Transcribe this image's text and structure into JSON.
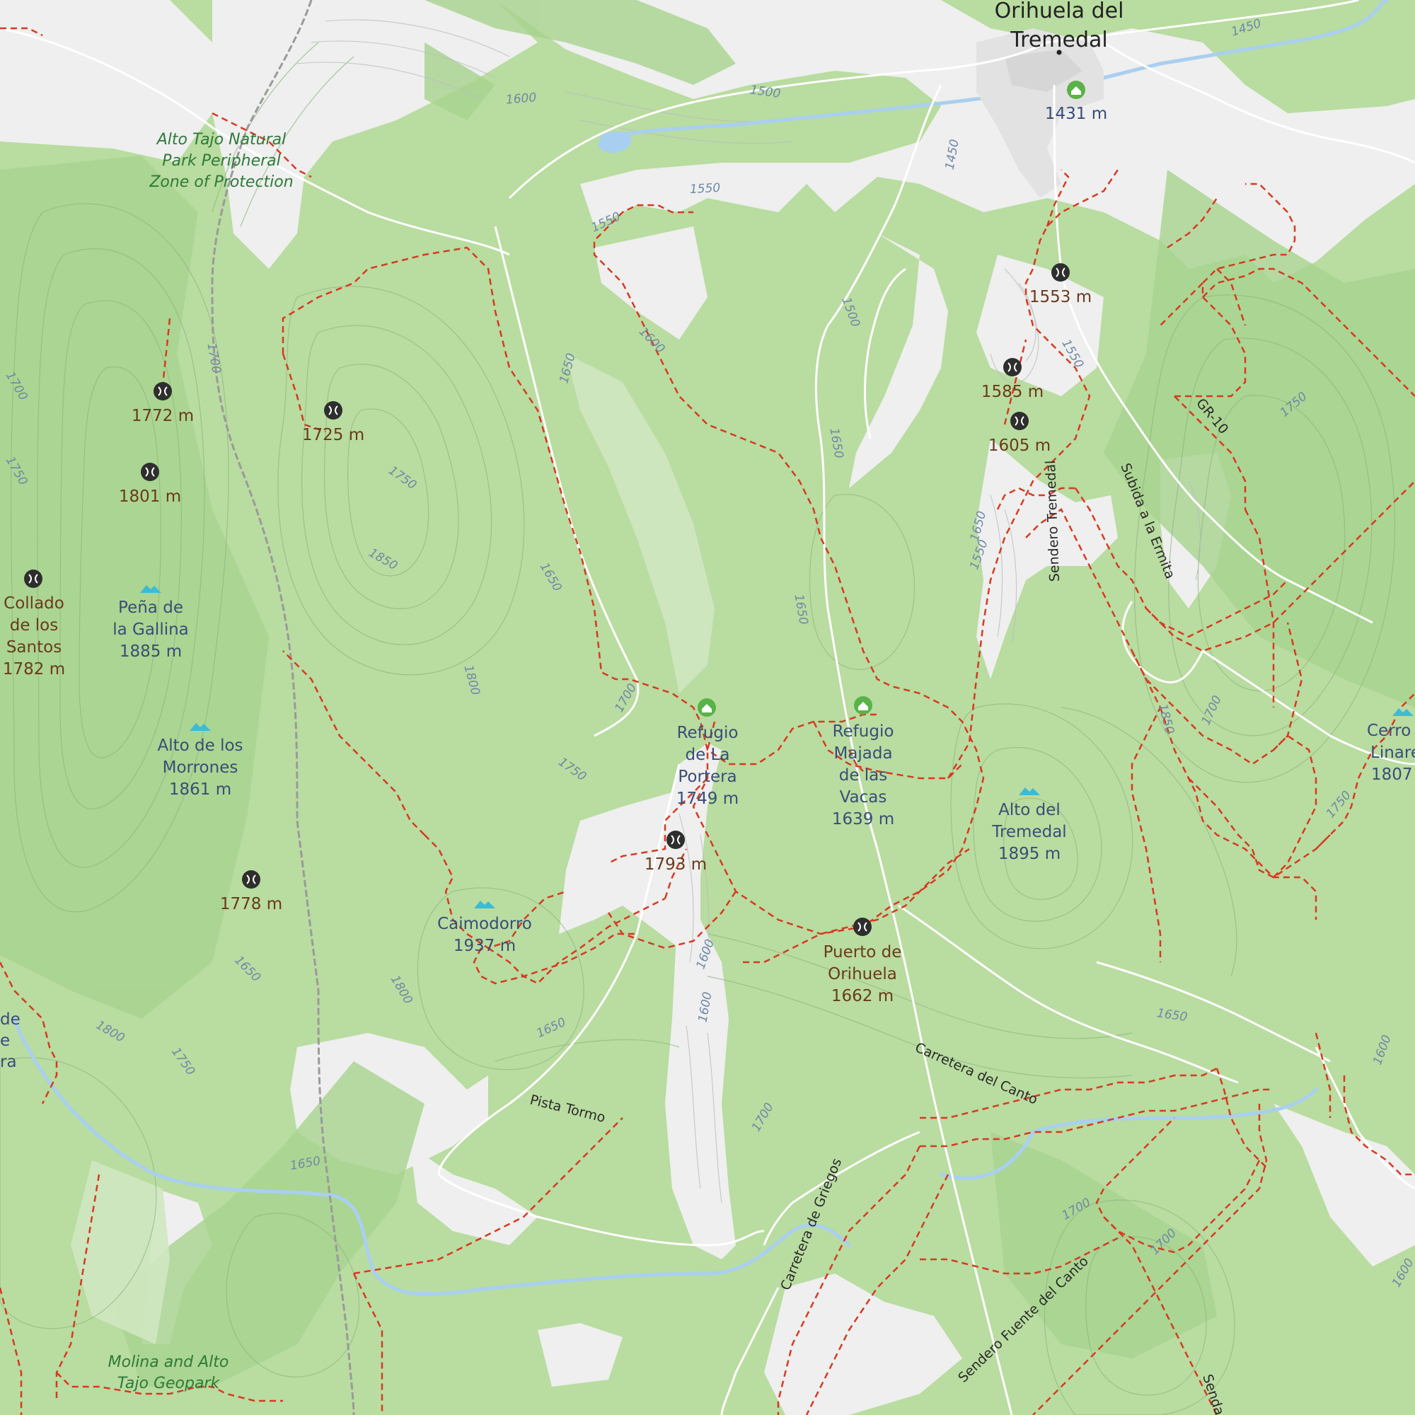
{
  "map": {
    "town": {
      "name_line1": "Orihuela del",
      "name_line2": "Tremedal",
      "elevation": "1431 m"
    },
    "protected_areas": [
      {
        "line1": "Alto Tajo Natural",
        "line2": "Park Peripheral",
        "line3": "Zone of Protection"
      },
      {
        "line1": "Molina and Alto",
        "line2": "Tajo Geopark"
      }
    ],
    "peaks": [
      {
        "line1": "Peña de",
        "line2": "la Gallina",
        "elevation": "1885 m"
      },
      {
        "line1": "Alto de los",
        "line2": "Morrones",
        "elevation": "1861 m"
      },
      {
        "line1": "Caimodorro",
        "elevation": "1937 m"
      },
      {
        "line1": "Alto del",
        "line2": "Tremedal",
        "elevation": "1895 m"
      },
      {
        "line1": "Cerro",
        "line2": "Linare",
        "elevation": "1807"
      }
    ],
    "passes": [
      {
        "line1": "Collado",
        "line2": "de los",
        "line3": "Santos",
        "elevation": "1782 m"
      },
      {
        "line1": "Puerto de",
        "line2": "Orihuela",
        "elevation": "1662 m"
      }
    ],
    "pass_points": [
      "1772 m",
      "1725 m",
      "1801 m",
      "1778 m",
      "1793 m",
      "1553 m",
      "1585 m",
      "1605 m"
    ],
    "huts": [
      {
        "line1": "Refugio",
        "line2": "de La",
        "line3": "Portera",
        "elevation": "1749 m"
      },
      {
        "line1": "Refugio",
        "line2": "Majada",
        "line3": "de las",
        "line4": "Vacas",
        "elevation": "1639 m"
      }
    ],
    "roads": [
      "Carretera del Canto",
      "Pista Tormo",
      "Carretera de Griegos",
      "Sendero Fuente del Canto",
      "Sendero Tremedal",
      "Subida a la Ermita",
      "GR-10",
      "Senda"
    ],
    "contour_labels": [
      "1600",
      "1500",
      "1450",
      "1450",
      "1550",
      "1550",
      "1600",
      "1650",
      "1700",
      "1700",
      "1750",
      "1750",
      "1850",
      "1650",
      "1800",
      "1700",
      "1750",
      "1500",
      "1650",
      "1650",
      "1550",
      "1550",
      "1750",
      "1850",
      "1700",
      "1750",
      "1650",
      "1600",
      "1650",
      "1800",
      "1750",
      "1800",
      "1650",
      "1600",
      "1700",
      "1650",
      "1700",
      "1700",
      "1600",
      "1600",
      "1650"
    ],
    "partial_labels": [
      "de",
      "e",
      "ra"
    ],
    "colors": {
      "forest": "#b9dca0",
      "forest_dark": "#a8d38f",
      "meadow": "#eeefee",
      "trail": "#d63a22",
      "water": "#a9cff0",
      "road": "#ffffff",
      "peak_icon": "#3bbbd6",
      "hut_icon": "#59b348",
      "pass_icon": "#2e2e2e",
      "boundary": "#9a9a9a"
    }
  }
}
